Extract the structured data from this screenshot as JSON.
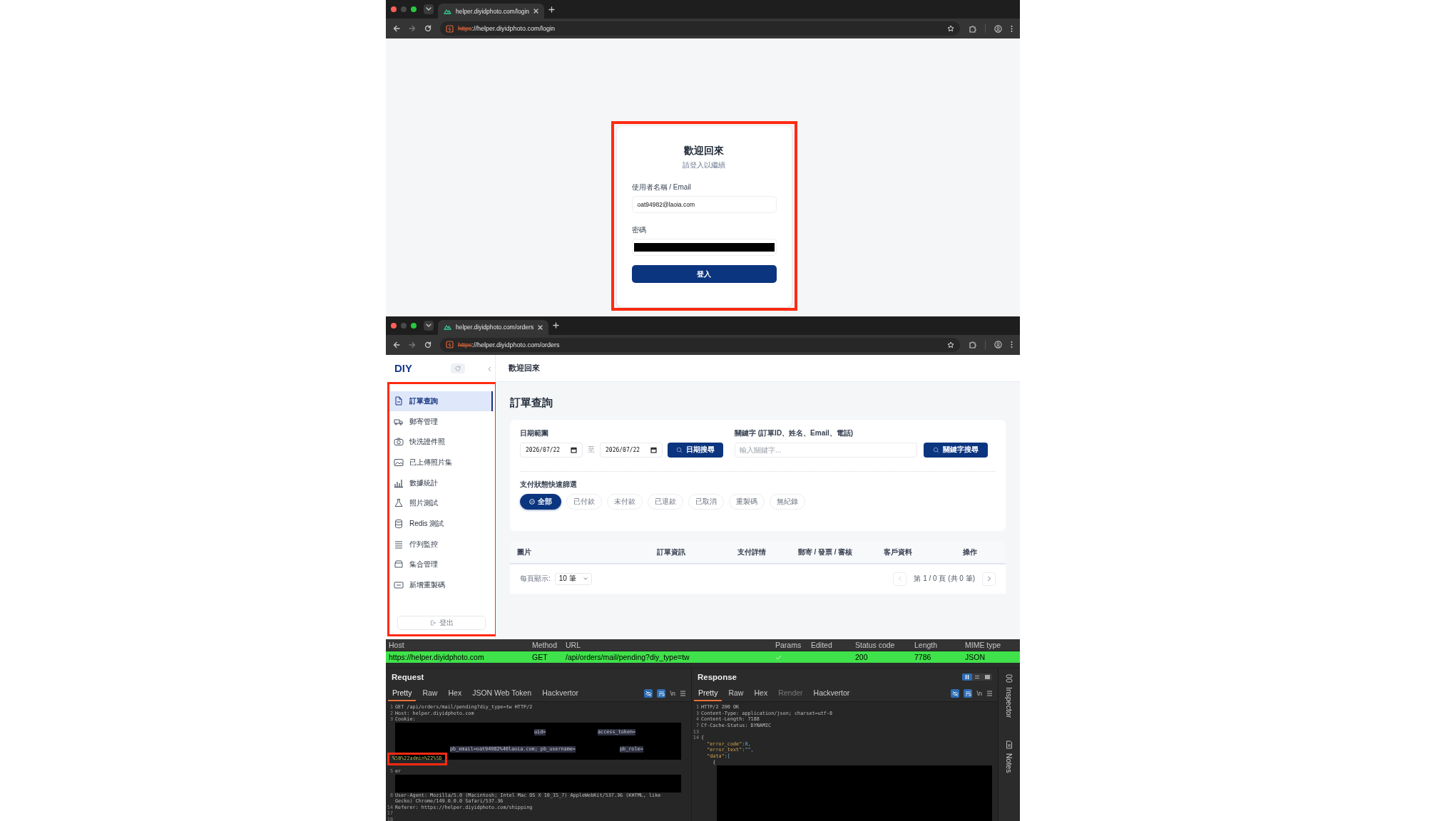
{
  "browser_login": {
    "tab_title": "helper.diyidphoto.com/login",
    "url_scheme": "https",
    "url_rest": "://helper.diyidphoto.com/login"
  },
  "login": {
    "title": "歡迎回來",
    "subtitle": "請登入以繼續",
    "username_label": "使用者名稱 / Email",
    "username_value": "oat94982@laoia.com",
    "password_label": "密碼",
    "submit": "登入"
  },
  "browser_orders": {
    "tab_title": "helper.diyidphoto.com/orders",
    "url_scheme": "https",
    "url_rest": "://helper.diyidphoto.com/orders"
  },
  "app": {
    "logo": "DIY",
    "header_title": "歡迎回來",
    "page_title": "訂單查詢",
    "sidebar": {
      "items": [
        {
          "label": "訂單查詢",
          "selected": true
        },
        {
          "label": "郵寄管理",
          "selected": false
        },
        {
          "label": "快洗證件照",
          "selected": false
        },
        {
          "label": "已上傳照片集",
          "selected": false
        },
        {
          "label": "數據統計",
          "selected": false
        },
        {
          "label": "照片測試",
          "selected": false
        },
        {
          "label": "Redis 測試",
          "selected": false
        },
        {
          "label": "佇列監控",
          "selected": false
        },
        {
          "label": "集合管理",
          "selected": false
        },
        {
          "label": "新增重製碼",
          "selected": false
        }
      ],
      "logout": "登出"
    },
    "filters": {
      "date_label": "日期範圍",
      "date_from": "2026/07/22",
      "date_sep": "至",
      "date_to": "2026/07/22",
      "date_button": "日期搜尋",
      "keyword_label": "關鍵字 (訂單ID、姓名、Email、電話)",
      "keyword_placeholder": "輸入關鍵字...",
      "keyword_button": "關鍵字搜尋",
      "status_label": "支付狀態快速篩選",
      "chips": [
        {
          "label": "全部",
          "selected": true
        },
        {
          "label": "已付款",
          "selected": false
        },
        {
          "label": "未付款",
          "selected": false
        },
        {
          "label": "已退款",
          "selected": false
        },
        {
          "label": "已取消",
          "selected": false
        },
        {
          "label": "重製碼",
          "selected": false
        },
        {
          "label": "無紀錄",
          "selected": false
        }
      ]
    },
    "table": {
      "columns": [
        "圖片",
        "訂單資訊",
        "支付詳情",
        "郵寄 / 發票 / 審核",
        "客戶資料",
        "操作"
      ],
      "page_size_label": "每頁顯示:",
      "page_size": "10 筆",
      "pagination": "第 1 / 0 頁 (共 0 筆)",
      "prev_disabled": true,
      "next_disabled": false
    }
  },
  "proxy": {
    "columns": [
      "Host",
      "Method",
      "URL",
      "Params",
      "Edited",
      "Status code",
      "Length",
      "MIME type"
    ],
    "rows": [
      {
        "host": "https://helper.diyidphoto.com",
        "method": "GET",
        "url": "/api/orders/mail/pending?diy_type=tw",
        "params": true,
        "status": "200",
        "length": "7786",
        "mime": "JSON",
        "color": "#3fe24a"
      }
    ],
    "request": {
      "title": "Request",
      "newline": "\\n",
      "tabs": [
        {
          "label": "Pretty",
          "selected": true
        },
        {
          "label": "Raw",
          "selected": false
        },
        {
          "label": "Hex",
          "selected": false
        },
        {
          "label": "JSON Web Token",
          "selected": false
        },
        {
          "label": "Hackvertor",
          "selected": false
        }
      ],
      "lines": [
        {
          "kind": "code",
          "num": "1",
          "text": "GET /api/orders/mail/pending?diy_type=tw HTTP/2"
        },
        {
          "kind": "code",
          "num": "2",
          "text": "Host: helper.diyidphoto.com"
        },
        {
          "kind": "code",
          "num": "3",
          "text": "Cookie:"
        },
        {
          "kind": "cookie",
          "parts": [
            "uid=",
            "access_token=",
            "pb_email=oat94982%40laoia.com; pb_username=",
            "pb_role=",
            "%5B%22admin%22%5D"
          ]
        },
        {
          "kind": "code",
          "num": "5",
          "text": "er"
        },
        {
          "kind": "redacted"
        },
        {
          "kind": "code",
          "num": "8",
          "text": "User-Agent: Mozilla/5.0 (Macintosh; Intel Mac OS X 10_15_7) AppleWebKit/537.36 (KHTML, like"
        },
        {
          "kind": "continuation",
          "text": "Gecko) Chrome/149.0.0.0 Safari/537.36"
        },
        {
          "kind": "code",
          "num": "14",
          "text": "Referer: https://helper.diyidphoto.com/shipping"
        },
        {
          "kind": "code",
          "num": "17"
        },
        {
          "kind": "code",
          "num": "18"
        }
      ]
    },
    "response": {
      "title": "Response",
      "newline": "\\n",
      "tabs": [
        {
          "label": "Pretty",
          "selected": true,
          "disabled": false
        },
        {
          "label": "Raw",
          "selected": false,
          "disabled": false
        },
        {
          "label": "Hex",
          "selected": false,
          "disabled": false
        },
        {
          "label": "Render",
          "selected": false,
          "disabled": true
        },
        {
          "label": "Hackvertor",
          "selected": false,
          "disabled": false
        }
      ],
      "lines": [
        {
          "kind": "code",
          "num": "1",
          "text": "HTTP/2 200 OK"
        },
        {
          "kind": "code",
          "num": "3",
          "text": "Content-Type: application/json; charset=utf-8"
        },
        {
          "kind": "code",
          "num": "4",
          "text": "Content-Length: 7188"
        },
        {
          "kind": "code",
          "num": "7",
          "text": "Cf-Cache-Status: DYNAMIC"
        },
        {
          "kind": "code",
          "num": "13"
        },
        {
          "kind": "code",
          "num": "14",
          "text": "{"
        },
        {
          "kind": "json",
          "key": "  \"error_code\":",
          "value": "0,"
        },
        {
          "kind": "json",
          "key": "  \"error_text\":",
          "value": "\"\","
        },
        {
          "kind": "json",
          "key": "  \"data\":",
          "value": "["
        },
        {
          "kind": "continuation",
          "text": "    {"
        },
        {
          "kind": "redacted"
        }
      ]
    },
    "side_tabs": [
      "Inspector",
      "Notes"
    ]
  }
}
